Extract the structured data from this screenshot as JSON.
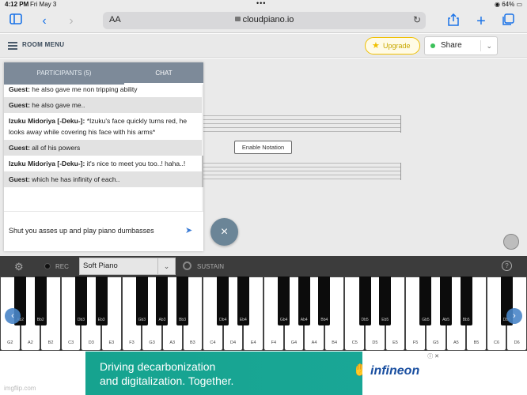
{
  "status": {
    "time": "4:12 PM",
    "date": "Fri May 3",
    "dots": "•••",
    "battery": "64%"
  },
  "browser": {
    "aa": "AA",
    "url": "cloudpiano.io"
  },
  "header": {
    "room_menu": "ROOM MENU",
    "upgrade_label": "Upgrade",
    "share_label": "Share"
  },
  "chat": {
    "tabs": [
      "PARTICIPANTS (5)",
      "CHAT"
    ],
    "messages": [
      {
        "sender": "Guest:",
        "text": " he also gave me non tripping ability"
      },
      {
        "sender": "Guest:",
        "text": " he also gave me.."
      },
      {
        "sender": "Izuku Midoriya [-Deku-]:",
        "text": " *Izuku's face quickly turns red, he looks away while covering his face with his arms*"
      },
      {
        "sender": "Guest:",
        "text": " all of his powers"
      },
      {
        "sender": "Izuku Midoriya [-Deku-]:",
        "text": " it's nice to meet you too..! haha..!"
      },
      {
        "sender": "Guest:",
        "text": " which he has infinity of each.."
      }
    ],
    "input_value": "Shut you asses up and play piano dumbasses"
  },
  "notation_button": "Enable Notation",
  "instrument_bar": {
    "rec_label": "REC",
    "instrument": "Soft Piano",
    "sustain_label": "SUSTAIN",
    "help": "?"
  },
  "keyboard": {
    "white_keys": [
      "G2",
      "A2",
      "B2",
      "C3",
      "D3",
      "E3",
      "F3",
      "G3",
      "A3",
      "B3",
      "C4",
      "D4",
      "E4",
      "F4",
      "G4",
      "A4",
      "B4",
      "C5",
      "D5",
      "E5",
      "F5",
      "G5",
      "A5",
      "B5",
      "C6",
      "D6"
    ],
    "black_keys": [
      "Ab2",
      "Bb2",
      "Db3",
      "Eb3",
      "Gb3",
      "Ab3",
      "Bb3",
      "Db4",
      "Eb4",
      "Gb4",
      "Ab4",
      "Bb4",
      "Db5",
      "Eb5",
      "Gb5",
      "Ab5",
      "Bb5",
      "Db6"
    ]
  },
  "ad": {
    "line1": "Driving decarbonization",
    "line2": "and digitalization. Together.",
    "brand": "infineon"
  },
  "watermark": "imgflip.com"
}
